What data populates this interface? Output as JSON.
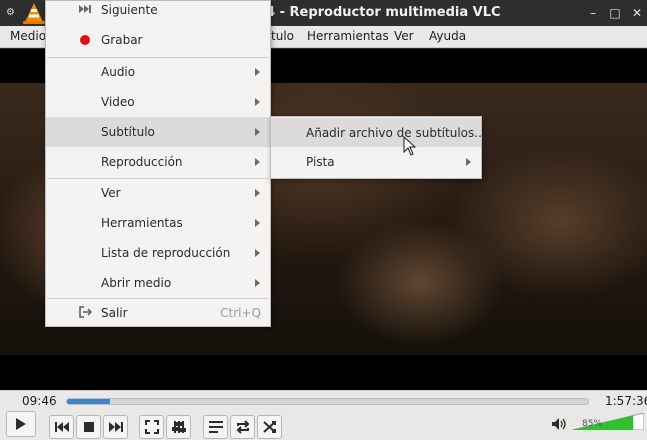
{
  "window": {
    "title": "4 - Reproductor multimedia VLC"
  },
  "menubar": {
    "items": [
      "Medio",
      "Subtítulo",
      "Herramientas",
      "Ver",
      "Ayuda"
    ]
  },
  "context_menu": {
    "siguiente": "Siguiente",
    "grabar": "Grabar",
    "audio": "Audio",
    "video": "Video",
    "subtitulo": "Subtítulo",
    "reproduccion": "Reproducción",
    "ver": "Ver",
    "herramientas": "Herramientas",
    "lista": "Lista de reproducción",
    "abrir": "Abrir medio",
    "salir": "Salir",
    "salir_shortcut": "Ctrl+Q"
  },
  "submenu": {
    "anadir": "Añadir archivo de subtítulos...",
    "pista": "Pista"
  },
  "controls": {
    "time_current": "09:46",
    "time_total": "1:57:36",
    "progress_fraction": 0.083,
    "volume_label": "85%",
    "volume_fraction": 0.85
  },
  "colors": {
    "accent": "#3d85c6",
    "record": "#e01010",
    "volume": "#2fc12f"
  }
}
